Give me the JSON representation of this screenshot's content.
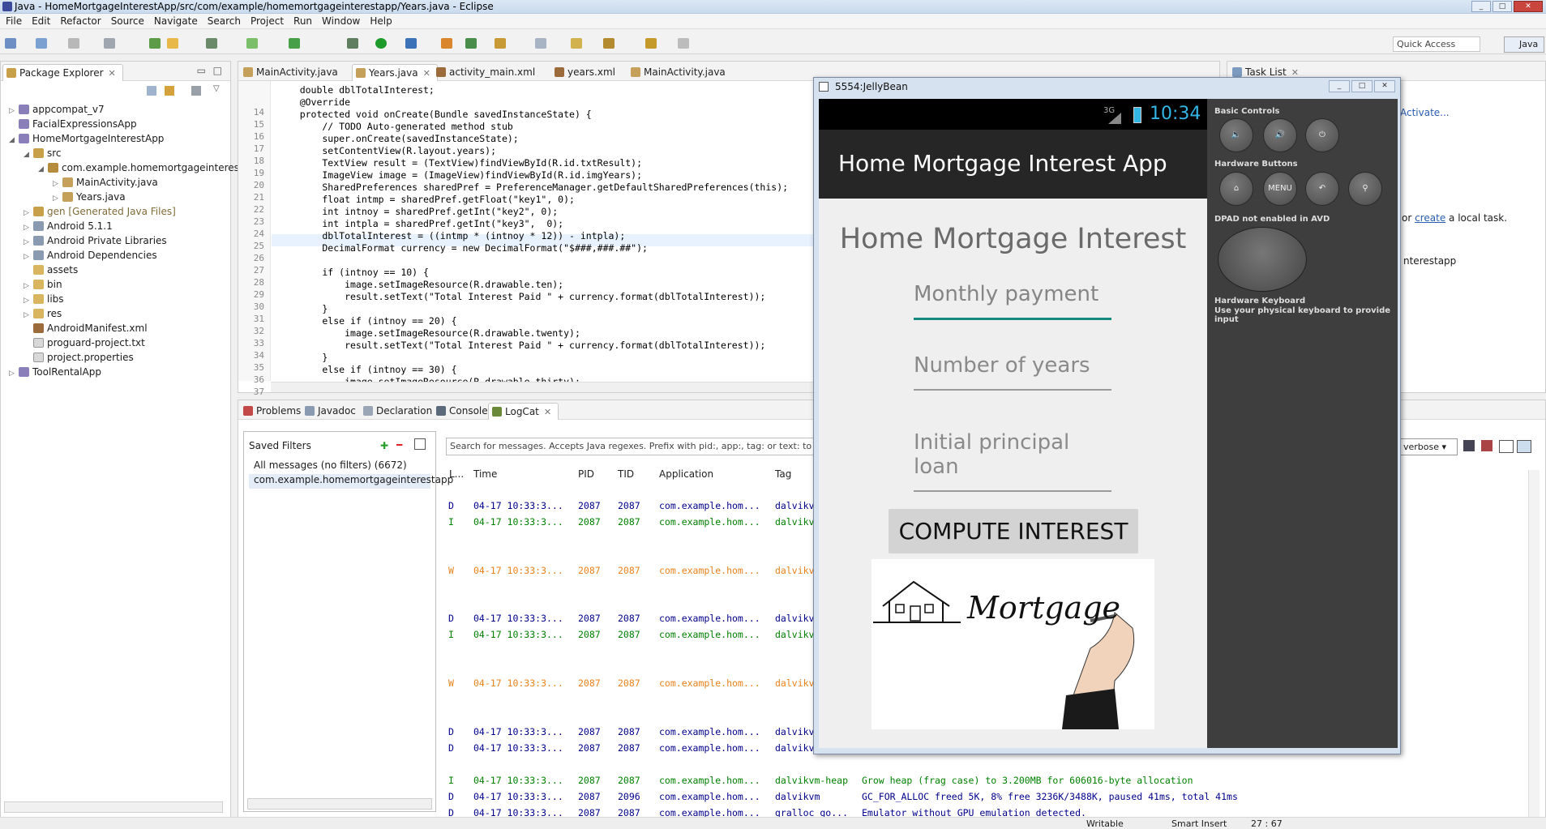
{
  "window": {
    "title": "Java - HomeMortgageInterestApp/src/com/example/homemortgageinterestapp/Years.java - Eclipse"
  },
  "menu": [
    "File",
    "Edit",
    "Refactor",
    "Source",
    "Navigate",
    "Search",
    "Project",
    "Run",
    "Window",
    "Help"
  ],
  "toolbar": {
    "quick_access": "Quick Access",
    "perspective": "Java"
  },
  "package_explorer": {
    "title": "Package Explorer",
    "nodes": [
      "appcompat_v7",
      "FacialExpressionsApp",
      "HomeMortgageInterestApp",
      "src",
      "com.example.homemortgageinteresta",
      "MainActivity.java",
      "Years.java",
      "gen [Generated Java Files]",
      "Android 5.1.1",
      "Android Private Libraries",
      "Android Dependencies",
      "assets",
      "bin",
      "libs",
      "res",
      "AndroidManifest.xml",
      "proguard-project.txt",
      "project.properties",
      "ToolRentalApp"
    ]
  },
  "editor": {
    "tabs": [
      "MainActivity.java",
      "Years.java",
      "activity_main.xml",
      "years.xml",
      "MainActivity.java"
    ],
    "lines": [
      {
        "n": "14",
        "t": "    double dblTotalInterest;"
      },
      {
        "n": "15",
        "t": "    @Override"
      },
      {
        "n": "16",
        "t": "    protected void onCreate(Bundle savedInstanceState) {"
      },
      {
        "n": "17",
        "t": "        // TODO Auto-generated method stub"
      },
      {
        "n": "18",
        "t": "        super.onCreate(savedInstanceState);"
      },
      {
        "n": "19",
        "t": "        setContentView(R.layout.years);"
      },
      {
        "n": "20",
        "t": "        TextView result = (TextView)findViewById(R.id.txtResult);"
      },
      {
        "n": "21",
        "t": "        ImageView image = (ImageView)findViewById(R.id.imgYears);"
      },
      {
        "n": "22",
        "t": "        SharedPreferences sharedPref = PreferenceManager.getDefaultSharedPreferences(this);"
      },
      {
        "n": "23",
        "t": "        float intmp = sharedPref.getFloat(\"key1\", 0);"
      },
      {
        "n": "24",
        "t": "        int intnoy = sharedPref.getInt(\"key2\", 0);"
      },
      {
        "n": "25",
        "t": "        int intpla = sharedPref.getInt(\"key3\",  0);"
      },
      {
        "n": "26",
        "t": "        dblTotalInterest = ((intmp * (intnoy * 12)) - intpla);"
      },
      {
        "n": "27",
        "t": "        DecimalFormat currency = new DecimalFormat(\"$###,###.##\");"
      },
      {
        "n": "28",
        "t": ""
      },
      {
        "n": "29",
        "t": "        if (intnoy == 10) {"
      },
      {
        "n": "30",
        "t": "            image.setImageResource(R.drawable.ten);"
      },
      {
        "n": "31",
        "t": "            result.setText(\"Total Interest Paid \" + currency.format(dblTotalInterest));"
      },
      {
        "n": "32",
        "t": "        }"
      },
      {
        "n": "33",
        "t": "        else if (intnoy == 20) {"
      },
      {
        "n": "34",
        "t": "            image.setImageResource(R.drawable.twenty);"
      },
      {
        "n": "35",
        "t": "            result.setText(\"Total Interest Paid \" + currency.format(dblTotalInterest));"
      },
      {
        "n": "36",
        "t": "        }"
      },
      {
        "n": "37",
        "t": "        else if (intnoy == 30) {"
      },
      {
        "n": "38",
        "t": "            image.setImageResource(R.drawable.thirty);"
      }
    ]
  },
  "bottom": {
    "tabs": [
      "Problems",
      "Javadoc",
      "Declaration",
      "Console",
      "LogCat"
    ],
    "saved_filters_title": "Saved Filters",
    "filters": [
      "All messages (no filters) (6672)",
      "com.example.homemortgageinterestapp"
    ],
    "search_placeholder": "Search for messages. Accepts Java regexes. Prefix with pid:, app:, tag: or text: to limit scope.",
    "columns": [
      "L...",
      "Time",
      "PID",
      "TID",
      "Application",
      "Tag"
    ],
    "verbose": "verbose",
    "rows": [
      {
        "l": "D",
        "time": "04-17 10:33:3...",
        "pid": "2087",
        "tid": "2087",
        "app": "com.example.hom...",
        "tag": "dalvikv",
        "msg": ""
      },
      {
        "l": "I",
        "time": "04-17 10:33:3...",
        "pid": "2087",
        "tid": "2087",
        "app": "com.example.hom...",
        "tag": "dalvikv",
        "msg": ""
      },
      {
        "l": "W",
        "time": "04-17 10:33:3...",
        "pid": "2087",
        "tid": "2087",
        "app": "com.example.hom...",
        "tag": "dalvikv",
        "msg": ""
      },
      {
        "l": "D",
        "time": "04-17 10:33:3...",
        "pid": "2087",
        "tid": "2087",
        "app": "com.example.hom...",
        "tag": "dalvikv",
        "msg": ""
      },
      {
        "l": "I",
        "time": "04-17 10:33:3...",
        "pid": "2087",
        "tid": "2087",
        "app": "com.example.hom...",
        "tag": "dalvikv",
        "msg": ""
      },
      {
        "l": "W",
        "time": "04-17 10:33:3...",
        "pid": "2087",
        "tid": "2087",
        "app": "com.example.hom...",
        "tag": "dalvikv",
        "msg": ""
      },
      {
        "l": "D",
        "time": "04-17 10:33:3...",
        "pid": "2087",
        "tid": "2087",
        "app": "com.example.hom...",
        "tag": "dalvikv",
        "msg": ""
      },
      {
        "l": "D",
        "time": "04-17 10:33:3...",
        "pid": "2087",
        "tid": "2087",
        "app": "com.example.hom...",
        "tag": "dalvikv",
        "msg": ""
      },
      {
        "l": "I",
        "time": "04-17 10:33:3...",
        "pid": "2087",
        "tid": "2087",
        "app": "com.example.hom...",
        "tag": "dalvikvm-heap",
        "msg": "Grow heap (frag case) to 3.200MB for 606016-byte allocation"
      },
      {
        "l": "D",
        "time": "04-17 10:33:3...",
        "pid": "2087",
        "tid": "2096",
        "app": "com.example.hom...",
        "tag": "dalvikvm",
        "msg": "GC_FOR_ALLOC freed 5K, 8% free 3236K/3488K, paused 41ms, total 41ms"
      },
      {
        "l": "D",
        "time": "04-17 10:33:3...",
        "pid": "2087",
        "tid": "2087",
        "app": "com.example.hom...",
        "tag": "gralloc_go...",
        "msg": "Emulator without GPU emulation detected."
      }
    ]
  },
  "tasklist": {
    "title": "Task List",
    "activate": "Activate...",
    "hint_or": "or",
    "hint_link": "create",
    "hint_rest": "a local task.",
    "item": "nterestapp"
  },
  "status": {
    "writable": "Writable",
    "insert": "Smart Insert",
    "pos": "27 : 67"
  },
  "emulator": {
    "title": "5554:JellyBean",
    "signal": "3G",
    "clock": "10:34",
    "app_title": "Home Mortgage Interest App",
    "heading": "Home Mortgage Interest",
    "field1": "Monthly payment",
    "field2": "Number of years",
    "field3": "Initial principal loan",
    "button": "COMPUTE INTEREST",
    "image_text": "Mortgage",
    "controls": {
      "basic": "Basic Controls",
      "hardware": "Hardware Buttons",
      "menu": "MENU",
      "dpad": "DPAD not enabled in AVD",
      "keyboard": "Hardware Keyboard",
      "keyboard_hint": "Use your physical keyboard to provide input"
    }
  }
}
